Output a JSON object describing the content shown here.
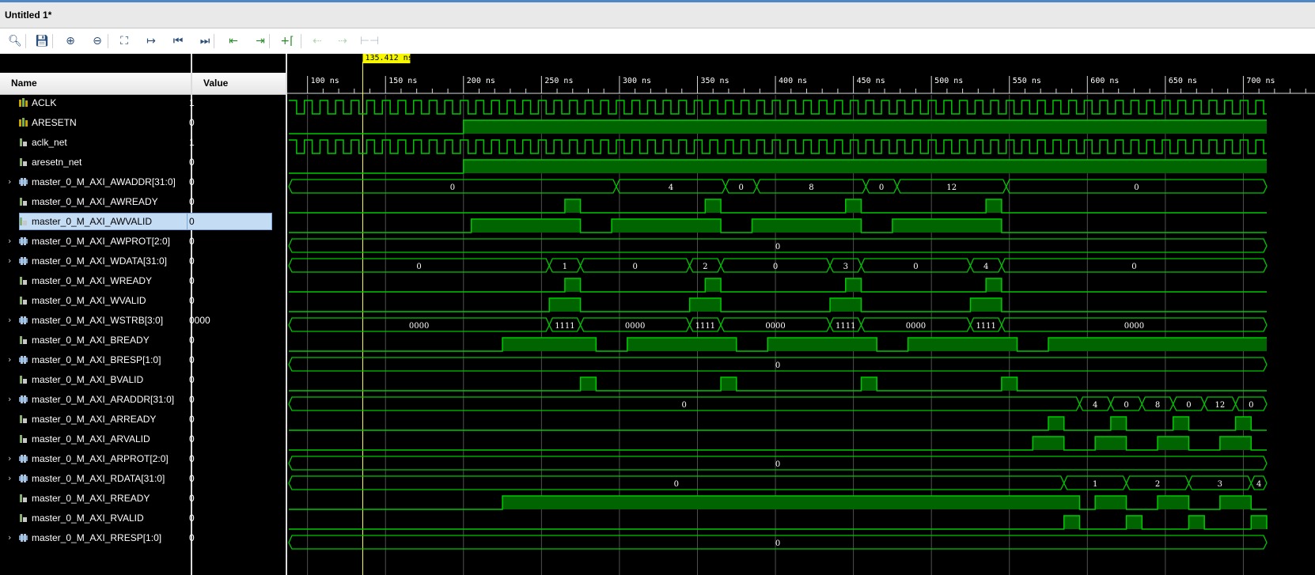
{
  "window": {
    "title": "Untitled 1*"
  },
  "toolbar": {
    "buttons": [
      {
        "name": "search-icon",
        "glyph": "🔍︎",
        "disabled": false
      },
      {
        "name": "save-icon",
        "glyph": "💾︎",
        "disabled": false
      },
      {
        "name": "zoom-in-icon",
        "glyph": "⊕",
        "disabled": false
      },
      {
        "name": "zoom-out-icon",
        "glyph": "⊖",
        "disabled": false
      },
      {
        "name": "zoom-fit-icon",
        "glyph": "⛶",
        "disabled": false
      },
      {
        "name": "go-to-cursor-icon",
        "glyph": "↦",
        "disabled": false
      },
      {
        "name": "go-to-time-zero-icon",
        "glyph": "⏮",
        "disabled": false
      },
      {
        "name": "go-to-last-time-icon",
        "glyph": "⏭",
        "disabled": false
      },
      {
        "name": "previous-transition-icon",
        "glyph": "⇤",
        "disabled": false
      },
      {
        "name": "next-transition-icon",
        "glyph": "⇥",
        "disabled": false
      },
      {
        "name": "add-marker-icon",
        "glyph": "+⌈",
        "disabled": false
      },
      {
        "name": "previous-marker-icon",
        "glyph": "⇠",
        "disabled": true
      },
      {
        "name": "next-marker-icon",
        "glyph": "⇢",
        "disabled": true
      },
      {
        "name": "swap-cursors-icon",
        "glyph": "⊢⊣",
        "disabled": true
      }
    ]
  },
  "columns": {
    "name": "Name",
    "value": "Value"
  },
  "cursor": {
    "label": "135.412 ns",
    "time": 135.412
  },
  "timeline": {
    "ticks": [
      "100 ns",
      "150 ns",
      "200 ns",
      "250 ns",
      "300 ns",
      "350 ns",
      "400 ns",
      "450 ns",
      "500 ns",
      "550 ns",
      "600 ns",
      "650 ns",
      "700 ns"
    ],
    "tick_times": [
      100,
      150,
      200,
      250,
      300,
      350,
      400,
      450,
      500,
      550,
      600,
      650,
      700
    ],
    "view_start": 88,
    "view_end": 715
  },
  "colors": {
    "wave": "#00c800",
    "fill": "#006400",
    "grid": "#505050",
    "cursor": "#ffff4d",
    "cursor_label_bg": "#f7f700",
    "bg": "#000000"
  },
  "signals": [
    {
      "name": "ACLK",
      "value": "1",
      "kind": "clock",
      "icon": "clock-port-icon",
      "expandable": false
    },
    {
      "name": "ARESETN",
      "value": "0",
      "kind": "bit",
      "icon": "clock-port-icon",
      "expandable": false,
      "edges": [
        [
          88,
          0
        ],
        [
          200,
          1
        ]
      ]
    },
    {
      "name": "aclk_net",
      "value": "1",
      "kind": "clock",
      "icon": "net-icon",
      "expandable": false
    },
    {
      "name": "aresetn_net",
      "value": "0",
      "kind": "bit",
      "icon": "net-icon",
      "expandable": false,
      "edges": [
        [
          88,
          0
        ],
        [
          200,
          1
        ]
      ]
    },
    {
      "name": "master_0_M_AXI_AWADDR[31:0]",
      "value": "0",
      "kind": "bus",
      "icon": "bus-icon",
      "expandable": true,
      "segments": [
        [
          88,
          "0"
        ],
        [
          298,
          "4"
        ],
        [
          368,
          "0"
        ],
        [
          388,
          "8"
        ],
        [
          458,
          "0"
        ],
        [
          478,
          "12"
        ],
        [
          548,
          "0"
        ]
      ]
    },
    {
      "name": "master_0_M_AXI_AWREADY",
      "value": "0",
      "kind": "bit",
      "icon": "net-icon",
      "expandable": false,
      "edges": [
        [
          88,
          0
        ],
        [
          265,
          1
        ],
        [
          275,
          0
        ],
        [
          355,
          1
        ],
        [
          365,
          0
        ],
        [
          445,
          1
        ],
        [
          455,
          0
        ],
        [
          535,
          1
        ],
        [
          545,
          0
        ]
      ]
    },
    {
      "name": "master_0_M_AXI_AWVALID",
      "value": "0",
      "kind": "bit",
      "icon": "net-icon",
      "expandable": false,
      "selected": true,
      "edges": [
        [
          88,
          0
        ],
        [
          205,
          1
        ],
        [
          275,
          0
        ],
        [
          295,
          1
        ],
        [
          365,
          0
        ],
        [
          385,
          1
        ],
        [
          455,
          0
        ],
        [
          475,
          1
        ],
        [
          545,
          0
        ]
      ]
    },
    {
      "name": "master_0_M_AXI_AWPROT[2:0]",
      "value": "0",
      "kind": "bus",
      "icon": "bus-icon",
      "expandable": true,
      "segments": [
        [
          88,
          "0"
        ]
      ]
    },
    {
      "name": "master_0_M_AXI_WDATA[31:0]",
      "value": "0",
      "kind": "bus",
      "icon": "bus-icon",
      "expandable": true,
      "segments": [
        [
          88,
          "0"
        ],
        [
          255,
          "1"
        ],
        [
          275,
          "0"
        ],
        [
          345,
          "2"
        ],
        [
          365,
          "0"
        ],
        [
          435,
          "3"
        ],
        [
          455,
          "0"
        ],
        [
          525,
          "4"
        ],
        [
          545,
          "0"
        ]
      ]
    },
    {
      "name": "master_0_M_AXI_WREADY",
      "value": "0",
      "kind": "bit",
      "icon": "net-icon",
      "expandable": false,
      "edges": [
        [
          88,
          0
        ],
        [
          265,
          1
        ],
        [
          275,
          0
        ],
        [
          355,
          1
        ],
        [
          365,
          0
        ],
        [
          445,
          1
        ],
        [
          455,
          0
        ],
        [
          535,
          1
        ],
        [
          545,
          0
        ]
      ]
    },
    {
      "name": "master_0_M_AXI_WVALID",
      "value": "0",
      "kind": "bit",
      "icon": "net-icon",
      "expandable": false,
      "edges": [
        [
          88,
          0
        ],
        [
          255,
          1
        ],
        [
          275,
          0
        ],
        [
          345,
          1
        ],
        [
          365,
          0
        ],
        [
          435,
          1
        ],
        [
          455,
          0
        ],
        [
          525,
          1
        ],
        [
          545,
          0
        ]
      ]
    },
    {
      "name": "master_0_M_AXI_WSTRB[3:0]",
      "value": "0000",
      "kind": "bus",
      "icon": "bus-icon",
      "expandable": true,
      "segments": [
        [
          88,
          "0000"
        ],
        [
          255,
          "1111"
        ],
        [
          275,
          "0000"
        ],
        [
          345,
          "1111"
        ],
        [
          365,
          "0000"
        ],
        [
          435,
          "1111"
        ],
        [
          455,
          "0000"
        ],
        [
          525,
          "1111"
        ],
        [
          545,
          "0000"
        ]
      ]
    },
    {
      "name": "master_0_M_AXI_BREADY",
      "value": "0",
      "kind": "bit",
      "icon": "net-icon",
      "expandable": false,
      "edges": [
        [
          88,
          0
        ],
        [
          225,
          1
        ],
        [
          285,
          0
        ],
        [
          305,
          1
        ],
        [
          375,
          0
        ],
        [
          395,
          1
        ],
        [
          465,
          0
        ],
        [
          485,
          1
        ],
        [
          555,
          0
        ],
        [
          575,
          1
        ]
      ]
    },
    {
      "name": "master_0_M_AXI_BRESP[1:0]",
      "value": "0",
      "kind": "bus",
      "icon": "bus-icon",
      "expandable": true,
      "segments": [
        [
          88,
          "0"
        ]
      ]
    },
    {
      "name": "master_0_M_AXI_BVALID",
      "value": "0",
      "kind": "bit",
      "icon": "net-icon",
      "expandable": false,
      "edges": [
        [
          88,
          0
        ],
        [
          275,
          1
        ],
        [
          285,
          0
        ],
        [
          365,
          1
        ],
        [
          375,
          0
        ],
        [
          455,
          1
        ],
        [
          465,
          0
        ],
        [
          545,
          1
        ],
        [
          555,
          0
        ]
      ]
    },
    {
      "name": "master_0_M_AXI_ARADDR[31:0]",
      "value": "0",
      "kind": "bus",
      "icon": "bus-icon",
      "expandable": true,
      "segments": [
        [
          88,
          "0"
        ],
        [
          595,
          "4"
        ],
        [
          615,
          "0"
        ],
        [
          635,
          "8"
        ],
        [
          655,
          "0"
        ],
        [
          675,
          "12"
        ],
        [
          695,
          "0"
        ]
      ]
    },
    {
      "name": "master_0_M_AXI_ARREADY",
      "value": "0",
      "kind": "bit",
      "icon": "net-icon",
      "expandable": false,
      "edges": [
        [
          88,
          0
        ],
        [
          575,
          1
        ],
        [
          585,
          0
        ],
        [
          615,
          1
        ],
        [
          625,
          0
        ],
        [
          655,
          1
        ],
        [
          665,
          0
        ],
        [
          695,
          1
        ],
        [
          705,
          0
        ]
      ]
    },
    {
      "name": "master_0_M_AXI_ARVALID",
      "value": "0",
      "kind": "bit",
      "icon": "net-icon",
      "expandable": false,
      "edges": [
        [
          88,
          0
        ],
        [
          565,
          1
        ],
        [
          585,
          0
        ],
        [
          605,
          1
        ],
        [
          625,
          0
        ],
        [
          645,
          1
        ],
        [
          665,
          0
        ],
        [
          685,
          1
        ],
        [
          705,
          0
        ]
      ]
    },
    {
      "name": "master_0_M_AXI_ARPROT[2:0]",
      "value": "0",
      "kind": "bus",
      "icon": "bus-icon",
      "expandable": true,
      "segments": [
        [
          88,
          "0"
        ]
      ]
    },
    {
      "name": "master_0_M_AXI_RDATA[31:0]",
      "value": "0",
      "kind": "bus",
      "icon": "bus-icon",
      "expandable": true,
      "segments": [
        [
          88,
          "0"
        ],
        [
          585,
          "1"
        ],
        [
          625,
          "2"
        ],
        [
          665,
          "3"
        ],
        [
          705,
          "4"
        ]
      ]
    },
    {
      "name": "master_0_M_AXI_RREADY",
      "value": "0",
      "kind": "bit",
      "icon": "net-icon",
      "expandable": false,
      "edges": [
        [
          88,
          0
        ],
        [
          225,
          1
        ],
        [
          595,
          0
        ],
        [
          605,
          1
        ],
        [
          625,
          0
        ],
        [
          645,
          1
        ],
        [
          665,
          0
        ],
        [
          685,
          1
        ],
        [
          705,
          0
        ]
      ]
    },
    {
      "name": "master_0_M_AXI_RVALID",
      "value": "0",
      "kind": "bit",
      "icon": "net-icon",
      "expandable": false,
      "edges": [
        [
          88,
          0
        ],
        [
          585,
          1
        ],
        [
          595,
          0
        ],
        [
          625,
          1
        ],
        [
          635,
          0
        ],
        [
          665,
          1
        ],
        [
          675,
          0
        ],
        [
          705,
          1
        ],
        [
          715,
          0
        ]
      ]
    },
    {
      "name": "master_0_M_AXI_RRESP[1:0]",
      "value": "0",
      "kind": "bus",
      "icon": "bus-icon",
      "expandable": true,
      "segments": [
        [
          88,
          "0"
        ]
      ]
    }
  ]
}
